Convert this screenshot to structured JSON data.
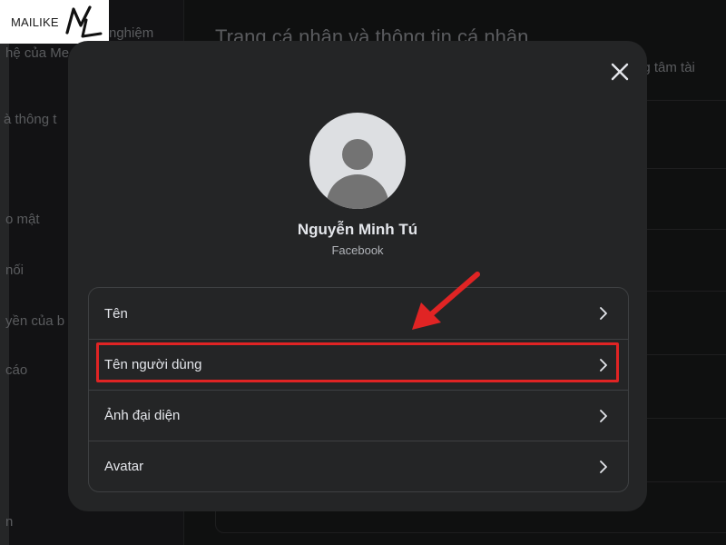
{
  "logo": {
    "text": "MAILIKE"
  },
  "background": {
    "sidebar_items": [
      "nghiệm",
      "hệ của Me",
      "à thông t",
      "o mật",
      "nối",
      "yền của b",
      "cáo",
      "n"
    ],
    "main_title": "Trang cá nhân và thông tin cá nhân",
    "main_subtitle": "ng tâm tài"
  },
  "modal": {
    "profile": {
      "name": "Nguyễn Minh Tú",
      "platform": "Facebook"
    },
    "menu_items": [
      {
        "label": "Tên"
      },
      {
        "label": "Tên người dùng"
      },
      {
        "label": "Ảnh đại diện"
      },
      {
        "label": "Avatar"
      }
    ]
  },
  "colors": {
    "highlight": "#e02424",
    "modal_bg": "#242526",
    "page_bg": "#18191a"
  },
  "icons": {
    "close": "close-icon",
    "chevron": "chevron-right-icon",
    "avatar": "default-avatar-icon"
  }
}
